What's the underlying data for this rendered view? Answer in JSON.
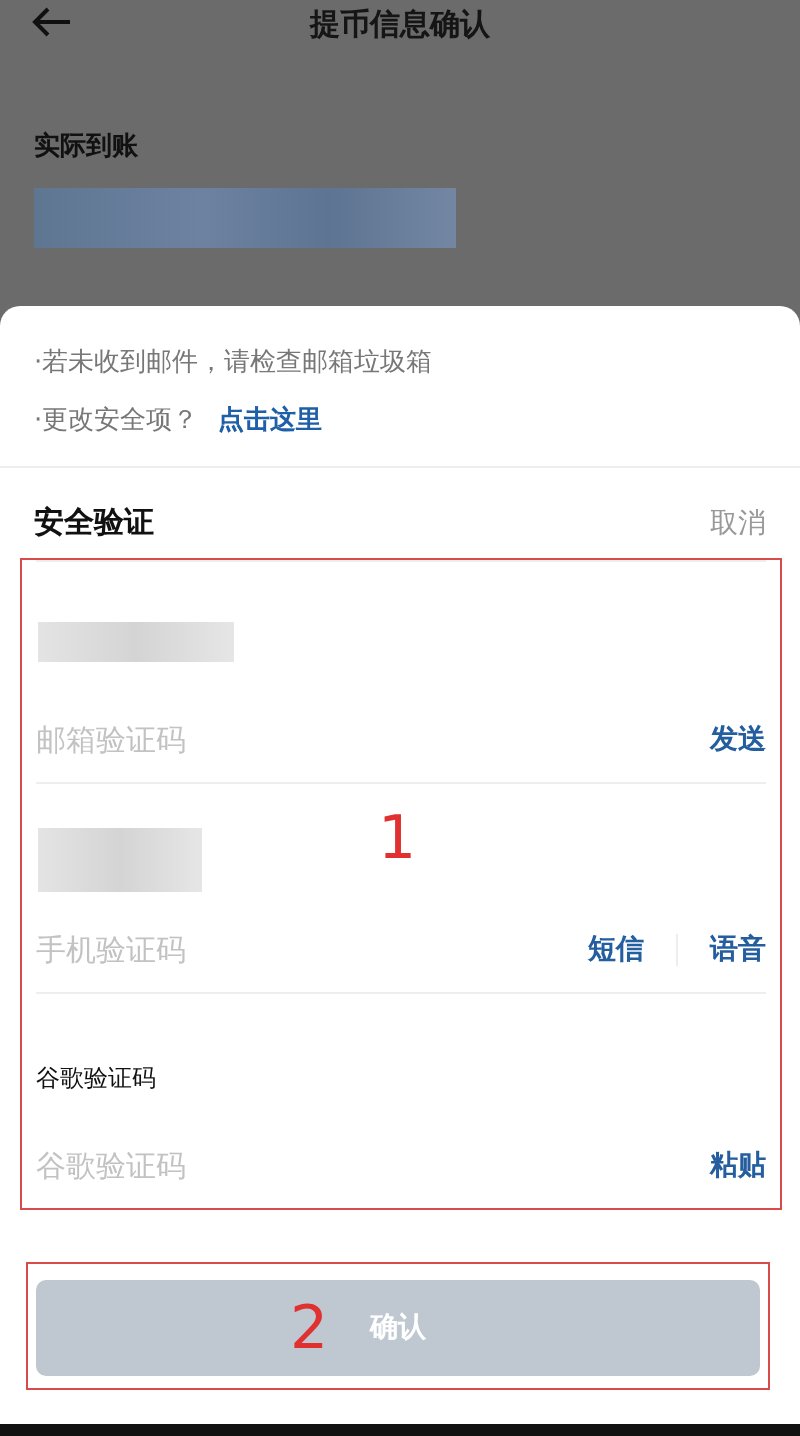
{
  "header": {
    "title": "提币信息确认"
  },
  "summary": {
    "label": "实际到账",
    "amount_masked": true
  },
  "notes": [
    {
      "text": "·若未收到邮件，请检查邮箱垃圾箱"
    },
    {
      "text": "·更改安全项？",
      "link": "点击这里"
    }
  ],
  "verification": {
    "title": "安全验证",
    "cancel": "取消",
    "fields": [
      {
        "kind": "masked",
        "placeholder": "邮箱验证码",
        "actions": [
          "发送"
        ]
      },
      {
        "kind": "masked",
        "placeholder": "手机验证码",
        "actions": [
          "短信",
          "语音"
        ]
      },
      {
        "kind": "labeled",
        "label": "谷歌验证码",
        "placeholder": "谷歌验证码",
        "actions": [
          "粘贴"
        ]
      }
    ]
  },
  "confirm": {
    "label": "确认",
    "disabled": true
  },
  "annotations": [
    {
      "label": "1"
    },
    {
      "label": "2"
    }
  ]
}
